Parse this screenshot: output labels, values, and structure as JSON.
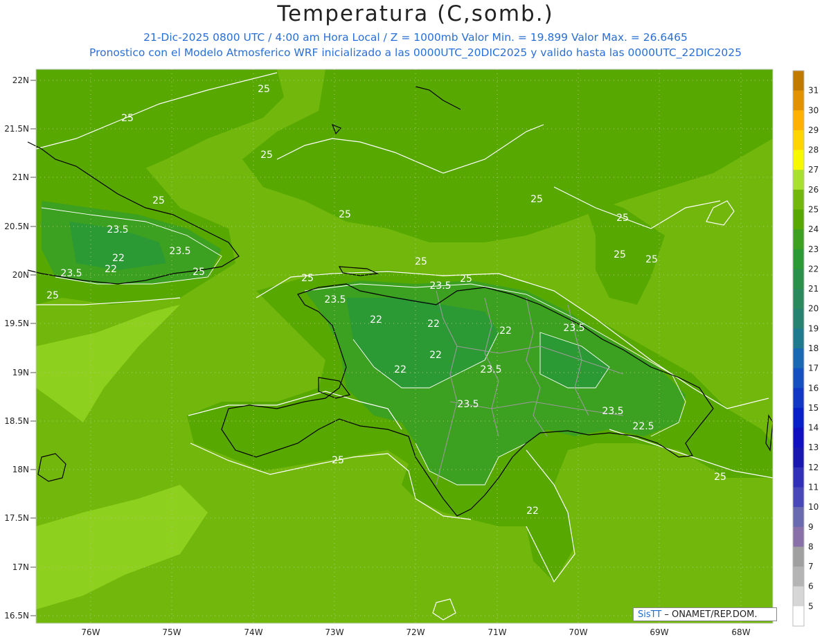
{
  "title": "Temperatura (C,somb.)",
  "subtitle_line1": "21-Dic-2025  0800 UTC / 4:00 am Hora Local / Z = 1000mb    Valor Min. = 19.899  Valor Max. = 26.6465",
  "subtitle_line2": "Pronostico con el Modelo Atmosferico WRF inicializado a las 0000UTC_20DIC2025 y valido hasta las  0000UTC_22DIC2025",
  "credit": {
    "sis": "SisTT",
    "rest": " – ONAMET/REP.DOM."
  },
  "lat_labels": [
    "22N",
    "21.5N",
    "21N",
    "20.5N",
    "20N",
    "19.5N",
    "19N",
    "18.5N",
    "18N",
    "17.5N",
    "17N",
    "16.5N"
  ],
  "lon_labels": [
    "76W",
    "75W",
    "74W",
    "73W",
    "72W",
    "71W",
    "70W",
    "69W",
    "68W"
  ],
  "colorbar": {
    "levels": [
      "31",
      "30",
      "29",
      "28",
      "27",
      "26",
      "25",
      "24",
      "23",
      "22",
      "21",
      "20",
      "19",
      "18",
      "17",
      "16",
      "15",
      "14",
      "13",
      "12",
      "11",
      "10",
      "9",
      "8",
      "7",
      "6",
      "5"
    ],
    "colors": [
      "#c07a00",
      "#e29200",
      "#ffb000",
      "#ffd400",
      "#f8f800",
      "#a8e030",
      "#72b80c",
      "#57a800",
      "#3ca020",
      "#2c9a34",
      "#2a904a",
      "#2a8a5e",
      "#288272",
      "#1f7a90",
      "#1a67b4",
      "#1450c0",
      "#1038c4",
      "#0820c8",
      "#1010c0",
      "#1818b0",
      "#3030b8",
      "#4848b8",
      "#6a6ab0",
      "#8a70a8",
      "#a0a0a0",
      "#b4b4b4",
      "#d6d6d6",
      "#ffffff"
    ]
  },
  "contour_labels": [
    "25",
    "25",
    "25",
    "25",
    "25",
    "25",
    "25",
    "25",
    "25",
    "25",
    "25",
    "25",
    "25",
    "25",
    "25",
    "25",
    "23.5",
    "23.5",
    "23.5",
    "23.5",
    "23.5",
    "23.5",
    "23.5",
    "23.5",
    "23.5",
    "22",
    "22",
    "22",
    "22",
    "22",
    "22",
    "22",
    "22.5",
    "22"
  ]
}
